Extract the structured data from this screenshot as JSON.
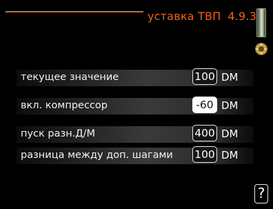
{
  "header": {
    "title": "уставка ТВП",
    "code": "4.9.3",
    "accent_color": "#e8641e"
  },
  "icons": {
    "status_icon": "heat-pump-status-icon",
    "help_icon": "question-mark-icon",
    "scrollbar": "scrollbar"
  },
  "rows": [
    {
      "label": "текущее значение",
      "value": "100",
      "unit": "DM",
      "selected": false
    },
    {
      "label": "вкл. компрессор",
      "value": "-60",
      "unit": "DM",
      "selected": true
    },
    {
      "label": "пуск разн.Д/М",
      "value": "400",
      "unit": "DM",
      "selected": false
    },
    {
      "label": "разница между доп. шагами",
      "value": "100",
      "unit": "DM",
      "selected": false
    }
  ],
  "help": {
    "label": "?"
  }
}
